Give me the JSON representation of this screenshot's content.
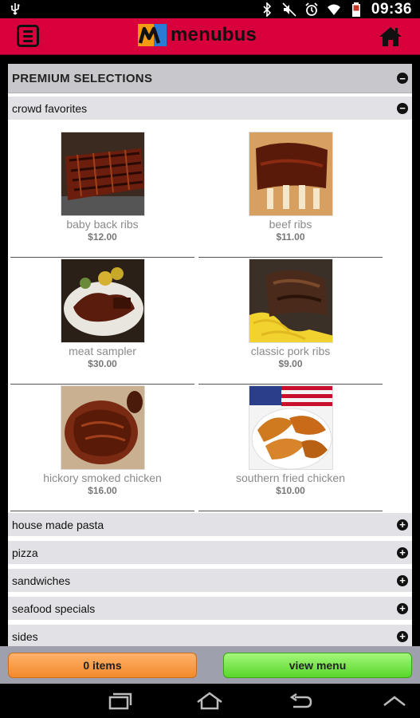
{
  "status_bar": {
    "time": "09:36",
    "icons": [
      "usb-icon",
      "bluetooth-icon",
      "mute-icon",
      "alarm-icon",
      "wifi-icon",
      "battery-icon"
    ]
  },
  "header": {
    "brand": "menubus",
    "menu_icon": "menu-icon",
    "home_icon": "home-icon",
    "colors": {
      "bar": "#d8003c"
    }
  },
  "menu": {
    "section_title": "PREMIUM SELECTIONS",
    "open_category": {
      "title": "crowd favorites",
      "items": [
        {
          "name": "baby back ribs",
          "price": "$12.00"
        },
        {
          "name": "beef ribs",
          "price": "$11.00"
        },
        {
          "name": "meat sampler",
          "price": "$30.00"
        },
        {
          "name": "classic pork ribs",
          "price": "$9.00"
        },
        {
          "name": "hickory smoked chicken",
          "price": "$16.00"
        },
        {
          "name": "southern fried chicken",
          "price": "$10.00"
        }
      ]
    },
    "closed_categories": [
      {
        "title": "house made pasta"
      },
      {
        "title": "pizza"
      },
      {
        "title": "sandwiches"
      },
      {
        "title": "seafood specials"
      },
      {
        "title": "sides"
      }
    ]
  },
  "footer": {
    "items_button": "0 items",
    "view_menu_button": "view menu"
  },
  "nav_bar": {
    "icons": [
      "recent-apps-icon",
      "home-nav-icon",
      "back-icon",
      "up-chevron-icon"
    ]
  }
}
